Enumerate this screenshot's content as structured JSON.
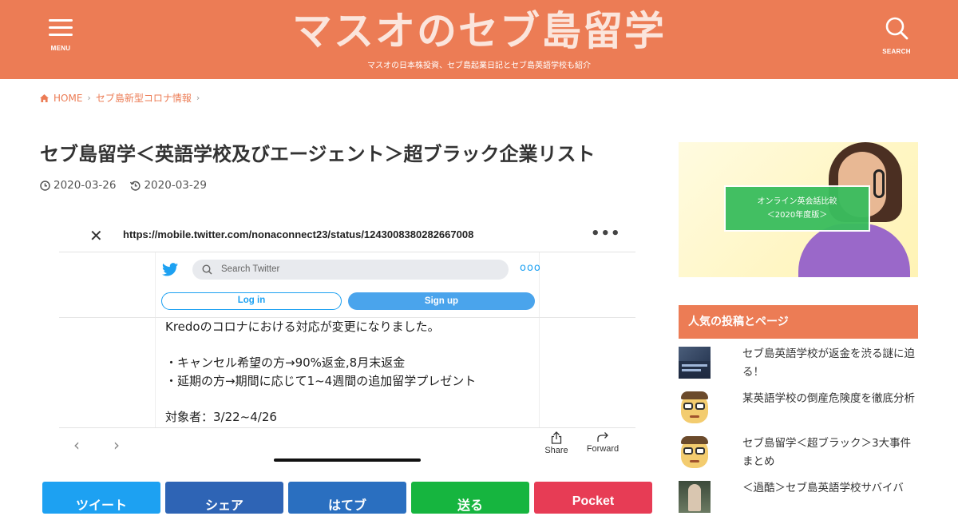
{
  "header": {
    "menu_label": "MENU",
    "site_title": "マスオのセブ島留学",
    "tagline": "マスオの日本株投資、セブ島起業日記とセブ島英語学校も紹介",
    "search_label": "SEARCH"
  },
  "breadcrumb": {
    "home": "HOME",
    "category": "セブ島新型コロナ情報"
  },
  "post": {
    "title": "セブ島留学＜英語学校及びエージェント＞超ブラック企業リスト",
    "published": "2020-03-26",
    "updated": "2020-03-29"
  },
  "screenshot": {
    "url": "https://mobile.twitter.com/nonaconnect23/status/1243008380282667008",
    "search_placeholder": "Search Twitter",
    "login_label": "Log in",
    "signup_label": "Sign up",
    "tweet_lines": [
      "Kredoのコロナにおける対応が変更になりました。",
      "・キャンセル希望の方→90%返金,8月末返金",
      "・延期の方→期間に応じて1~4週間の追加留学プレゼント",
      "対象者：3/22~4/26"
    ],
    "share_label": "Share",
    "forward_label": "Forward"
  },
  "share_buttons": {
    "twitter": "ツイート",
    "facebook": "シェア",
    "hatena": "はてブ",
    "line": "送る",
    "pocket": "Pocket"
  },
  "sidebar": {
    "ad_line1": "オンライン英会話比較",
    "ad_line2": "＜2020年度版＞",
    "popular_heading": "人気の投稿とページ",
    "popular_items": [
      "セブ島英語学校が返金を渋る謎に迫る！",
      "某英語学校の倒産危険度を徹底分析",
      "セブ島留学＜超ブラック＞3大事件まとめ",
      "＜過酷＞セブ島英語学校サバイバ"
    ]
  },
  "colors": {
    "brand": "#ec7c55",
    "twitter_blue": "#1da1f2",
    "line_green": "#16b53f",
    "pocket_red": "#e73c55"
  }
}
